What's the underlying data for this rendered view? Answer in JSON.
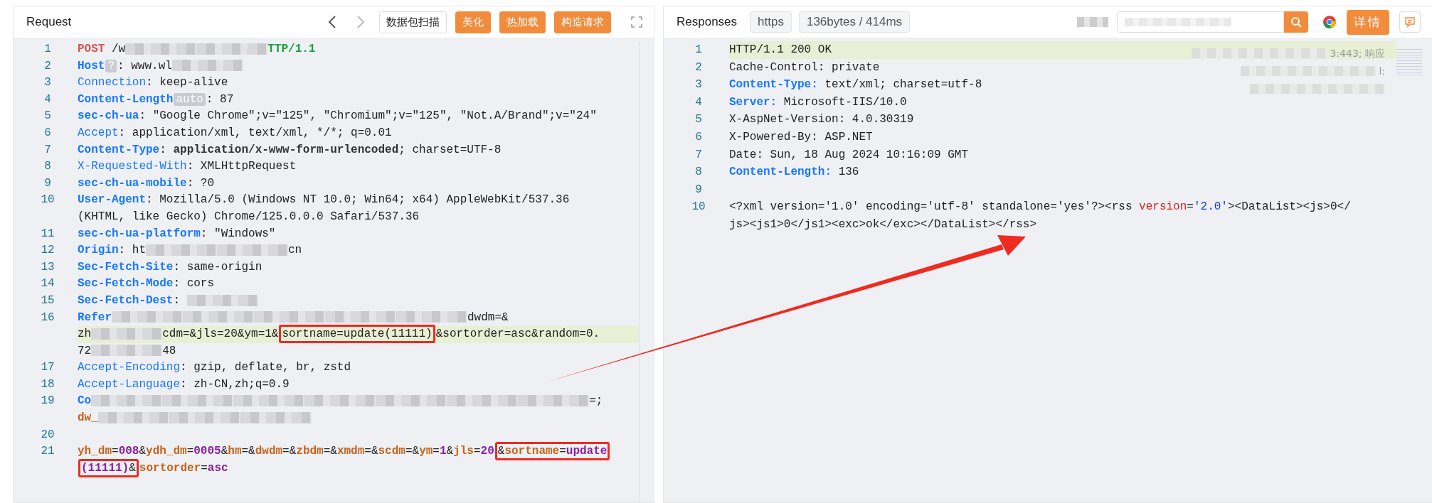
{
  "request": {
    "title": "Request",
    "toolbar": {
      "scan_button": "数据包扫描",
      "buttons": [
        "美化",
        "热加载",
        "构造请求"
      ]
    },
    "lines": [
      {
        "number": "1",
        "rows": [
          {
            "highlighted": false,
            "tokens": [
              {
                "kind": "method",
                "text": "POST"
              },
              {
                "kind": "plain",
                "text": " /w"
              },
              {
                "kind": "blur"
              },
              {
                "kind": "blur"
              },
              {
                "kind": "proto",
                "text": "TTP/1.1"
              }
            ]
          }
        ]
      },
      {
        "number": "2",
        "rows": [
          {
            "highlighted": false,
            "tokens": [
              {
                "kind": "key",
                "bold": true,
                "text": "Host"
              },
              {
                "kind": "badge",
                "text": "?"
              },
              {
                "kind": "plain",
                "text": ": www.wl"
              },
              {
                "kind": "blur"
              }
            ]
          }
        ]
      },
      {
        "number": "3",
        "rows": [
          {
            "highlighted": false,
            "tokens": [
              {
                "kind": "key",
                "bold": false,
                "text": "Connection"
              },
              {
                "kind": "plain",
                "text": ": keep-alive"
              }
            ]
          }
        ]
      },
      {
        "number": "4",
        "rows": [
          {
            "highlighted": false,
            "tokens": [
              {
                "kind": "key",
                "bold": true,
                "text": "Content-Length"
              },
              {
                "kind": "badge",
                "text": "auto"
              },
              {
                "kind": "plain",
                "text": ": 87"
              }
            ]
          }
        ]
      },
      {
        "number": "5",
        "rows": [
          {
            "highlighted": false,
            "tokens": [
              {
                "kind": "key",
                "bold": true,
                "text": "sec-ch-ua"
              },
              {
                "kind": "plain",
                "text": ": \"Google Chrome\";v=\"125\", \"Chromium\";v=\"125\", \"Not.A/Brand\";v=\"24\""
              }
            ]
          }
        ]
      },
      {
        "number": "6",
        "rows": [
          {
            "highlighted": false,
            "tokens": [
              {
                "kind": "key",
                "bold": false,
                "text": "Accept"
              },
              {
                "kind": "plain",
                "text": ": application/xml, text/xml, */*; q=0.01"
              }
            ]
          }
        ]
      },
      {
        "number": "7",
        "rows": [
          {
            "highlighted": false,
            "tokens": [
              {
                "kind": "key",
                "bold": true,
                "text": "Content-Type"
              },
              {
                "kind": "plain",
                "text": ": "
              },
              {
                "kind": "strong",
                "text": "application/x-www-form-urlencoded"
              },
              {
                "kind": "plain",
                "text": "; charset=UTF-8"
              }
            ]
          }
        ]
      },
      {
        "number": "8",
        "rows": [
          {
            "highlighted": false,
            "tokens": [
              {
                "kind": "key",
                "bold": false,
                "text": "X-Requested-With"
              },
              {
                "kind": "plain",
                "text": ": XMLHttpRequest"
              }
            ]
          }
        ]
      },
      {
        "number": "9",
        "rows": [
          {
            "highlighted": false,
            "tokens": [
              {
                "kind": "key",
                "bold": true,
                "text": "sec-ch-ua-mobile"
              },
              {
                "kind": "plain",
                "text": ": ?0"
              }
            ]
          }
        ]
      },
      {
        "number": "10",
        "rows": [
          {
            "highlighted": false,
            "tokens": [
              {
                "kind": "key",
                "bold": true,
                "text": "User-Agent"
              },
              {
                "kind": "plain",
                "text": ": Mozilla/5.0 (Windows NT 10.0; Win64; x64) AppleWebKit/537.36"
              }
            ]
          },
          {
            "highlighted": false,
            "tokens": [
              {
                "kind": "plain",
                "text": "(KHTML, like Gecko) Chrome/125.0.0.0 Safari/537.36"
              }
            ]
          }
        ]
      },
      {
        "number": "11",
        "rows": [
          {
            "highlighted": false,
            "tokens": [
              {
                "kind": "key",
                "bold": true,
                "text": "sec-ch-ua-platform"
              },
              {
                "kind": "plain",
                "text": ": \"Windows\""
              }
            ]
          }
        ]
      },
      {
        "number": "12",
        "rows": [
          {
            "highlighted": false,
            "tokens": [
              {
                "kind": "key",
                "bold": true,
                "text": "Origin"
              },
              {
                "kind": "plain",
                "text": ": ht"
              },
              {
                "kind": "blur"
              },
              {
                "kind": "blur"
              },
              {
                "kind": "plain",
                "text": "cn"
              }
            ]
          }
        ]
      },
      {
        "number": "13",
        "rows": [
          {
            "highlighted": false,
            "tokens": [
              {
                "kind": "key",
                "bold": true,
                "text": "Sec-Fetch-Site"
              },
              {
                "kind": "plain",
                "text": ": same-origin"
              }
            ]
          }
        ]
      },
      {
        "number": "14",
        "rows": [
          {
            "highlighted": false,
            "tokens": [
              {
                "kind": "key",
                "bold": true,
                "text": "Sec-Fetch-Mode"
              },
              {
                "kind": "plain",
                "text": ": cors"
              }
            ]
          }
        ]
      },
      {
        "number": "15",
        "rows": [
          {
            "highlighted": false,
            "tokens": [
              {
                "kind": "key",
                "bold": true,
                "text": "Sec-Fetch-Dest"
              },
              {
                "kind": "plain",
                "text": ": "
              },
              {
                "kind": "blur"
              }
            ]
          }
        ]
      },
      {
        "number": "16",
        "rows": [
          {
            "highlighted": false,
            "tokens": [
              {
                "kind": "key",
                "bold": true,
                "text": "Refer"
              },
              {
                "kind": "blur"
              },
              {
                "kind": "blur"
              },
              {
                "kind": "blur"
              },
              {
                "kind": "blur"
              },
              {
                "kind": "blur"
              },
              {
                "kind": "plain",
                "text": "dwdm=&"
              }
            ]
          },
          {
            "highlighted": true,
            "tokens": [
              {
                "kind": "plain",
                "text": "zh"
              },
              {
                "kind": "blur"
              },
              {
                "kind": "plain",
                "text": "cdm=&jls=20&ym=1&"
              },
              {
                "kind": "box",
                "parts": [
                  {
                    "kind": "plain",
                    "text": "sortname=update(11111)"
                  }
                ]
              },
              {
                "kind": "plain",
                "text": "&sortorder=asc&random=0."
              }
            ]
          },
          {
            "highlighted": false,
            "tokens": [
              {
                "kind": "plain",
                "text": "72"
              },
              {
                "kind": "blur"
              },
              {
                "kind": "plain",
                "text": "48"
              }
            ]
          }
        ]
      },
      {
        "number": "17",
        "rows": [
          {
            "highlighted": false,
            "tokens": [
              {
                "kind": "key",
                "bold": false,
                "text": "Accept-Encoding"
              },
              {
                "kind": "plain",
                "text": ": gzip, deflate, br, zstd"
              }
            ]
          }
        ]
      },
      {
        "number": "18",
        "rows": [
          {
            "highlighted": false,
            "tokens": [
              {
                "kind": "key",
                "bold": false,
                "text": "Accept-Language"
              },
              {
                "kind": "plain",
                "text": ": zh-CN,zh;q=0.9"
              }
            ]
          }
        ]
      },
      {
        "number": "19",
        "rows": [
          {
            "highlighted": false,
            "tokens": [
              {
                "kind": "key",
                "bold": true,
                "text": "Co"
              },
              {
                "kind": "blur"
              },
              {
                "kind": "blur"
              },
              {
                "kind": "blur"
              },
              {
                "kind": "blur"
              },
              {
                "kind": "blur"
              },
              {
                "kind": "blur"
              },
              {
                "kind": "blur"
              },
              {
                "kind": "plain",
                "text": "=;"
              }
            ]
          },
          {
            "highlighted": false,
            "tokens": [
              {
                "kind": "pname",
                "text": "dw_"
              },
              {
                "kind": "blur"
              },
              {
                "kind": "blur"
              },
              {
                "kind": "blur"
              }
            ]
          }
        ]
      },
      {
        "number": "20",
        "rows": [
          {
            "highlighted": false
          }
        ]
      },
      {
        "number": "21",
        "rows": [
          {
            "highlighted": false,
            "tokens": [
              {
                "kind": "pname",
                "text": "yh_dm"
              },
              {
                "kind": "plain",
                "text": "="
              },
              {
                "kind": "pval",
                "text": "008"
              },
              {
                "kind": "plain",
                "text": "&"
              },
              {
                "kind": "pname",
                "text": "ydh_dm"
              },
              {
                "kind": "plain",
                "text": "="
              },
              {
                "kind": "pval",
                "text": "0005"
              },
              {
                "kind": "plain",
                "text": "&"
              },
              {
                "kind": "pname",
                "text": "hm"
              },
              {
                "kind": "plain",
                "text": "=&"
              },
              {
                "kind": "pname",
                "text": "dwdm"
              },
              {
                "kind": "plain",
                "text": "=&"
              },
              {
                "kind": "pname",
                "text": "zbdm"
              },
              {
                "kind": "plain",
                "text": "=&"
              },
              {
                "kind": "pname",
                "text": "xmdm"
              },
              {
                "kind": "plain",
                "text": "=&"
              },
              {
                "kind": "pname",
                "text": "scdm"
              },
              {
                "kind": "plain",
                "text": "=&"
              },
              {
                "kind": "pname",
                "text": "ym"
              },
              {
                "kind": "plain",
                "text": "="
              },
              {
                "kind": "pval",
                "text": "1"
              },
              {
                "kind": "plain",
                "text": "&"
              },
              {
                "kind": "pname",
                "text": "jls"
              },
              {
                "kind": "plain",
                "text": "="
              },
              {
                "kind": "pval",
                "text": "20"
              },
              {
                "kind": "box",
                "parts": [
                  {
                    "kind": "plain",
                    "text": "&"
                  },
                  {
                    "kind": "pname",
                    "text": "sortname"
                  },
                  {
                    "kind": "plain",
                    "text": "="
                  },
                  {
                    "kind": "pval",
                    "text": "update"
                  }
                ]
              }
            ]
          },
          {
            "highlighted": false,
            "tokens": [
              {
                "kind": "box",
                "parts": [
                  {
                    "kind": "pval",
                    "text": "(11111)"
                  },
                  {
                    "kind": "plain",
                    "text": "&"
                  }
                ]
              },
              {
                "kind": "pname",
                "text": "sortorder"
              },
              {
                "kind": "plain",
                "text": "="
              },
              {
                "kind": "pval",
                "text": "asc"
              }
            ]
          }
        ]
      }
    ]
  },
  "response": {
    "title": "Responses",
    "tags": [
      "https",
      "136bytes / 414ms"
    ],
    "detail_button": "详情",
    "side_notes": [
      {
        "text": "3:443; 响应"
      },
      {
        "text": "l:"
      }
    ],
    "lines": [
      {
        "number": "1",
        "rows": [
          {
            "highlighted": true,
            "tokens": [
              {
                "kind": "plain",
                "text": "HTTP/1.1 200 OK"
              }
            ]
          }
        ]
      },
      {
        "number": "2",
        "rows": [
          {
            "highlighted": false,
            "tokens": [
              {
                "kind": "plain",
                "text": "Cache-Control: private"
              }
            ]
          }
        ]
      },
      {
        "number": "3",
        "rows": [
          {
            "highlighted": false,
            "tokens": [
              {
                "kind": "key",
                "bold": true,
                "text": "Content-Type:"
              },
              {
                "kind": "plain",
                "text": " text/xml; charset=utf-8"
              }
            ]
          }
        ]
      },
      {
        "number": "4",
        "rows": [
          {
            "highlighted": false,
            "tokens": [
              {
                "kind": "key",
                "bold": true,
                "text": "Server:"
              },
              {
                "kind": "plain",
                "text": " Microsoft-IIS/10.0"
              }
            ]
          }
        ]
      },
      {
        "number": "5",
        "rows": [
          {
            "highlighted": false,
            "tokens": [
              {
                "kind": "plain",
                "text": "X-AspNet-Version: 4.0.30319"
              }
            ]
          }
        ]
      },
      {
        "number": "6",
        "rows": [
          {
            "highlighted": false,
            "tokens": [
              {
                "kind": "plain",
                "text": "X-Powered-By: ASP.NET"
              }
            ]
          }
        ]
      },
      {
        "number": "7",
        "rows": [
          {
            "highlighted": false,
            "tokens": [
              {
                "kind": "plain",
                "text": "Date: Sun, 18 Aug 2024 10:16:09 GMT"
              }
            ]
          }
        ]
      },
      {
        "number": "8",
        "rows": [
          {
            "highlighted": false,
            "tokens": [
              {
                "kind": "key",
                "bold": true,
                "text": "Content-Length:"
              },
              {
                "kind": "plain",
                "text": " 136"
              }
            ]
          }
        ]
      },
      {
        "number": "9",
        "rows": [
          {
            "highlighted": false
          }
        ]
      },
      {
        "number": "10",
        "rows": [
          {
            "highlighted": false,
            "tokens": [
              {
                "kind": "plain",
                "text": "<?xml version='1.0' encoding='utf-8' standalone='yes'?><rss "
              },
              {
                "kind": "attr",
                "text": "version"
              },
              {
                "kind": "plain",
                "text": "="
              },
              {
                "kind": "str",
                "text": "'2.0'"
              },
              {
                "kind": "plain",
                "text": "><DataList><js>0</"
              }
            ]
          },
          {
            "highlighted": false,
            "tokens": [
              {
                "kind": "plain",
                "text": "js><js1>0</js1><exc>ok</exc></DataList></rss>"
              }
            ]
          }
        ]
      }
    ]
  }
}
